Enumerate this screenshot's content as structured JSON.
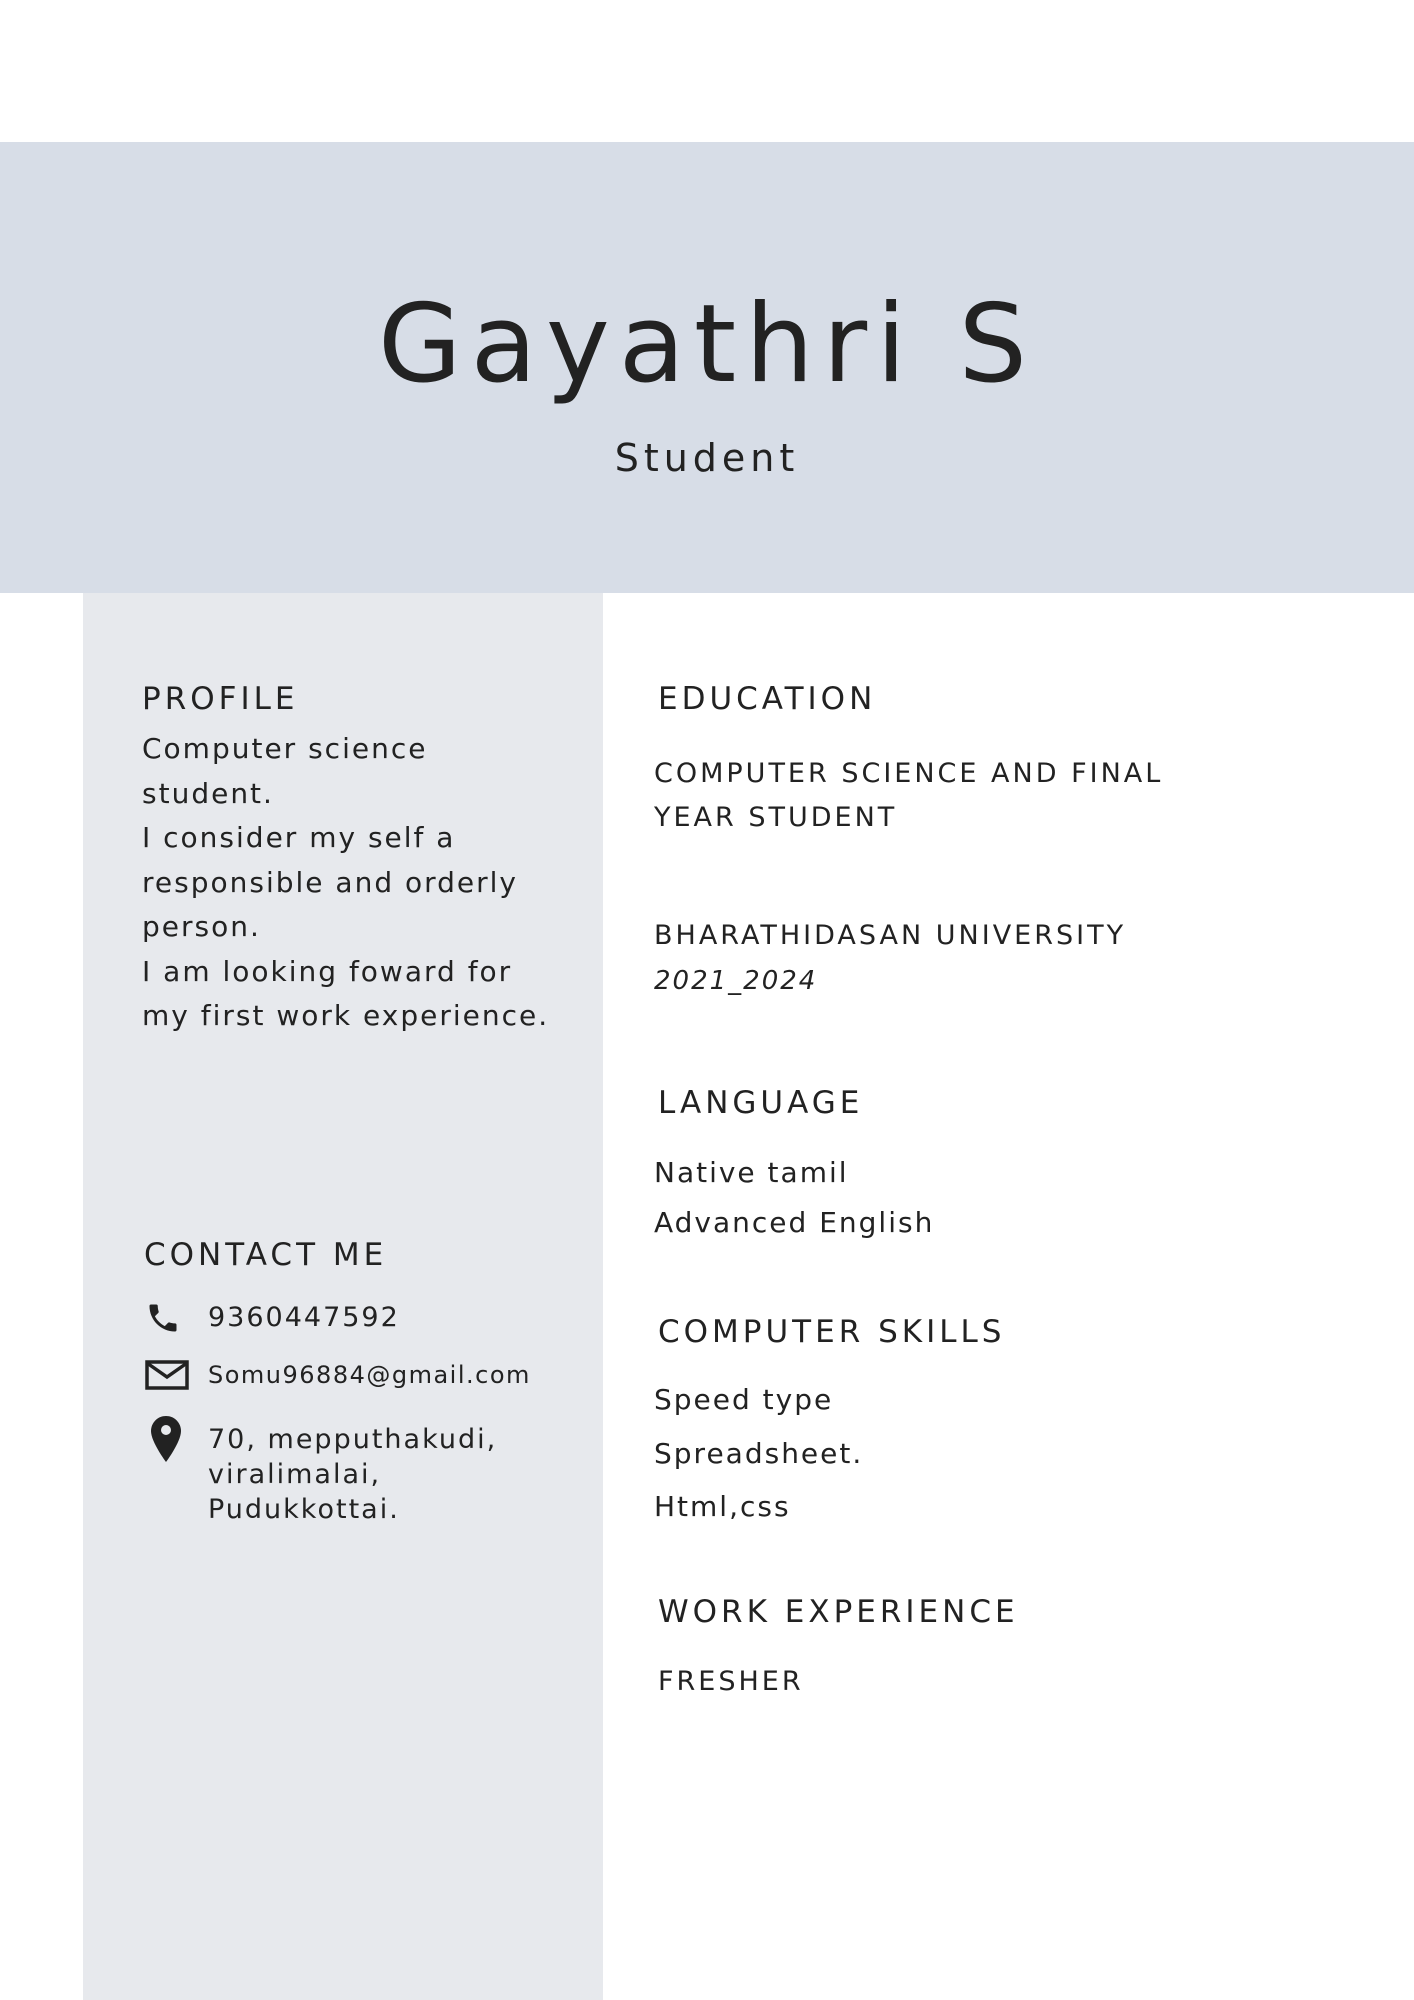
{
  "header": {
    "name": "Gayathri S",
    "role": "Student"
  },
  "profile": {
    "heading": "PROFILE",
    "lines": [
      "Computer science",
      "student.",
      "I consider my self a",
      "responsible and orderly",
      "person.",
      "I am looking foward for",
      "my first work experience."
    ]
  },
  "contact": {
    "heading": "CONTACT ME",
    "phone": "9360447592",
    "email": "Somu96884@gmail.com",
    "address_lines": [
      "70, mepputhakudi,",
      "viralimalai,",
      "Pudukkottai."
    ],
    "icons": {
      "phone": "phone-icon",
      "email": "envelope-icon",
      "address": "map-pin-icon"
    }
  },
  "education": {
    "heading": "EDUCATION",
    "degree_lines": [
      "COMPUTER SCIENCE AND FINAL",
      "YEAR STUDENT"
    ],
    "university": "BHARATHIDASAN UNIVERSITY",
    "years": "2021_2024"
  },
  "language": {
    "heading": "LANGUAGE",
    "items": [
      "Native tamil",
      "Advanced English"
    ]
  },
  "skills": {
    "heading": "COMPUTER SKILLS",
    "items": [
      "Speed type",
      "Spreadsheet.",
      "Html,css"
    ]
  },
  "work": {
    "heading": "WORK EXPERIENCE",
    "value": "FRESHER"
  },
  "colors": {
    "header_band": "#d7dde7",
    "sidebar": "#e7e9ed",
    "text": "#222222"
  }
}
